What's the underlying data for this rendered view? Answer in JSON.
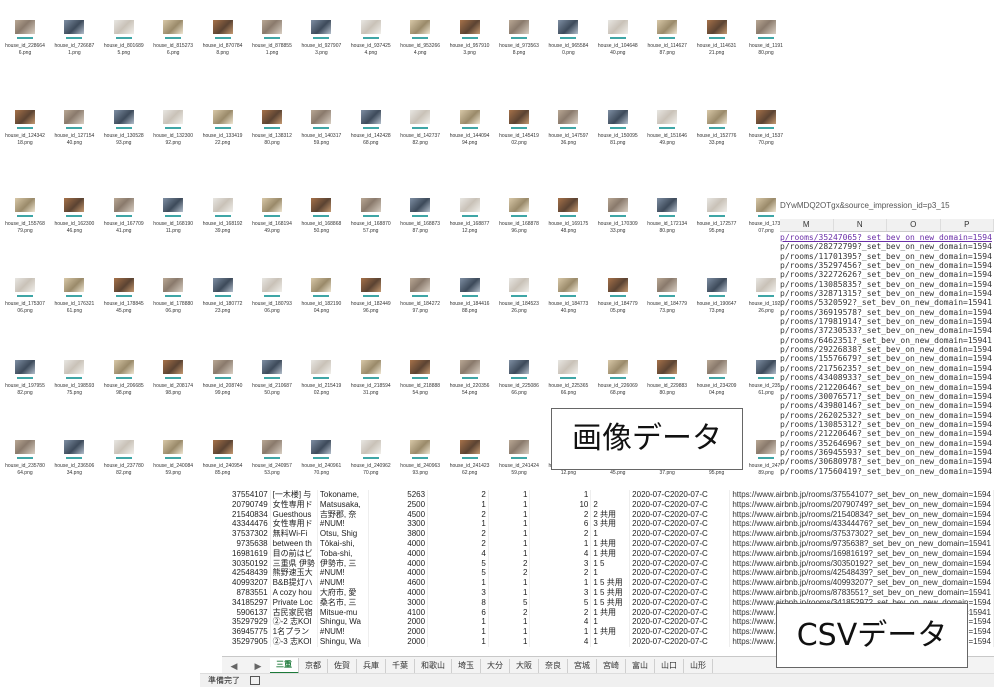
{
  "image_grid": {
    "rows": [
      [
        "house_id_228664\n6.png",
        "house_id_726687\n1.png",
        "house_id_801689\n5.png",
        "house_id_815273\n6.png",
        "house_id_870784\n8.png",
        "house_id_878855\n1.png",
        "house_id_927907\n3.png",
        "house_id_937425\n4.png",
        "house_id_953266\n4.png",
        "house_id_957910\n3.png",
        "house_id_973563\n8.png",
        "house_id_965584\n0.png",
        "house_id_104648\n40.png",
        "house_id_114627\n87.png",
        "house_id_114631\n21.png",
        "house_id_1191\n80.png"
      ],
      [
        "house_id_124342\n18.png",
        "house_id_127154\n40.png",
        "house_id_130528\n93.png",
        "house_id_132300\n92.png",
        "house_id_133419\n22.png",
        "house_id_138312\n80.png",
        "house_id_140317\n59.png",
        "house_id_142428\n68.png",
        "house_id_142737\n82.png",
        "house_id_144094\n94.png",
        "house_id_145419\n02.png",
        "house_id_147597\n36.png",
        "house_id_150095\n81.png",
        "house_id_151646\n49.png",
        "house_id_152776\n33.png",
        "house_id_1537\n70.png"
      ],
      [
        "house_id_155768\n79.png",
        "house_id_162300\n46.png",
        "house_id_167709\n41.png",
        "house_id_168190\n11.png",
        "house_id_168192\n39.png",
        "house_id_168194\n49.png",
        "house_id_168868\n50.png",
        "house_id_168870\n57.png",
        "house_id_168873\n87.png",
        "house_id_168877\n12.png",
        "house_id_168878\n96.png",
        "house_id_169175\n48.png",
        "house_id_170309\n33.png",
        "house_id_172134\n80.png",
        "house_id_172577\n95.png",
        "house_id_1730\n07.png"
      ],
      [
        "house_id_175307\n06.png",
        "house_id_176321\n61.png",
        "house_id_178845\n45.png",
        "house_id_178880\n06.png",
        "house_id_180772\n23.png",
        "house_id_180793\n06.png",
        "house_id_182190\n04.png",
        "house_id_182449\n96.png",
        "house_id_184272\n97.png",
        "house_id_184416\n88.png",
        "house_id_184523\n26.png",
        "house_id_184773\n40.png",
        "house_id_184779\n05.png",
        "house_id_184779\n73.png",
        "house_id_190647\n73.png",
        "house_id_1921\n26.png"
      ],
      [
        "house_id_197955\n82.png",
        "house_id_198593\n75.png",
        "house_id_206685\n98.png",
        "house_id_208174\n98.png",
        "house_id_208740\n99.png",
        "house_id_210687\n50.png",
        "house_id_215419\n02.png",
        "house_id_218594\n31.png",
        "house_id_218888\n54.png",
        "house_id_220356\n54.png",
        "house_id_225086\n66.png",
        "house_id_225365\n66.png",
        "house_id_226069\n68.png",
        "house_id_229883\n80.png",
        "house_id_234209\n04.png",
        "house_id_2351\n61.png"
      ],
      [
        "house_id_235780\n64.png",
        "house_id_236506\n34.png",
        "house_id_237780\n82.png",
        "house_id_240084\n59.png",
        "house_id_240954\n85.png",
        "house_id_240957\n53.png",
        "house_id_240961\n70.png",
        "house_id_240962\n70.png",
        "house_id_240963\n93.png",
        "house_id_241423\n62.png",
        "house_id_241424\n59.png",
        "house_id_241425\n12.png",
        "house_id_241425\n45.png",
        "house_id_241426\n37.png",
        "house_id_241427\n95.png",
        "house_id_2474\n89.png"
      ]
    ]
  },
  "csv_pane": {
    "url_fragment": "DYwMDQ2OTgx&source_impression_id=p3_15",
    "columns": [
      "M",
      "N",
      "O",
      "P"
    ],
    "links": [
      "p/rooms/35247065?_set_bev_on_new_domain=1594",
      "p/rooms/28272799?_set_bev_on_new_domain=1594",
      "p/rooms/11701395?_set_bev_on_new_domain=1594",
      "p/rooms/35297456?_set_bev_on_new_domain=1594",
      "p/rooms/32272626?_set_bev_on_new_domain=1594",
      "p/rooms/13085835?_set_bev_on_new_domain=1594",
      "p/rooms/32871315?_set_bev_on_new_domain=1594",
      "p/rooms/5320592?_set_bev_on_new_domain=15941",
      "p/rooms/36919578?_set_bev_on_new_domain=1594",
      "p/rooms/17981914?_set_bev_on_new_domain=1594",
      "p/rooms/37230533?_set_bev_on_new_domain=1594",
      "p/rooms/6462351?_set_bev_on_new_domain=15941",
      "p/rooms/29226838?_set_bev_on_new_domain=1594",
      "p/rooms/15576679?_set_bev_on_new_domain=1594",
      "p/rooms/21756235?_set_bev_on_new_domain=1594",
      "p/rooms/43408933?_set_bev_on_new_domain=1594",
      "p/rooms/21220646?_set_bev_on_new_domain=1594",
      "p/rooms/30076571?_set_bev_on_new_domain=1594",
      "p/rooms/43980146?_set_bev_on_new_domain=1594",
      "p/rooms/26202532?_set_bev_on_new_domain=1594",
      "p/rooms/13085312?_set_bev_on_new_domain=1594",
      "p/rooms/21220646?_set_bev_on_new_domain=1594",
      "p/rooms/35264696?_set_bev_on_new_domain=1594",
      "p/rooms/36945593?_set_bev_on_new_domain=1594",
      "p/rooms/30680978?_set_bev_on_new_domain=1594",
      "p/rooms/17560419?_set_bev_on_new_domain=1594"
    ]
  },
  "csv_rows": [
    [
      "37554107",
      "[一木楼] 与",
      "Tokoname,",
      "5263",
      "2",
      "1",
      "1",
      "",
      "2020-07-C2020-07-C",
      "https://www.airbnb.jp/rooms/37554107?_set_bev_on_new_domain=1594"
    ],
    [
      "20790749",
      "女性専用ド",
      "Matsusaka,",
      "2500",
      "1",
      "1",
      "10",
      "2",
      "2020-07-C2020-07-C",
      "https://www.airbnb.jp/rooms/20790749?_set_bev_on_new_domain=1594"
    ],
    [
      "21540834",
      "Guesthous",
      "吉野郡, 奈",
      "4500",
      "2",
      "1",
      "2",
      "2 共用",
      "2020-07-C2020-07-C",
      "https://www.airbnb.jp/rooms/21540834?_set_bev_on_new_domain=1594"
    ],
    [
      "43344476",
      "女性専用ド",
      "#NUM!",
      "3300",
      "1",
      "1",
      "6",
      "3 共用",
      "2020-07-C2020-07-C",
      "https://www.airbnb.jp/rooms/43344476?_set_bev_on_new_domain=1594"
    ],
    [
      "37537302",
      "無料Wi-Fi",
      "Otsu, Shig",
      "3800",
      "2",
      "1",
      "2",
      "1",
      "2020-07-C2020-07-C",
      "https://www.airbnb.jp/rooms/37537302?_set_bev_on_new_domain=1594"
    ],
    [
      "9735638",
      "between th",
      "Tōkai-shi,",
      "4000",
      "2",
      "1",
      "1",
      "1 共用",
      "2020-07-C2020-07-C",
      "https://www.airbnb.jp/rooms/9735638?_set_bev_on_new_domain=15941"
    ],
    [
      "16981619",
      "目の前はビ",
      "Toba-shi,",
      "4000",
      "4",
      "1",
      "4",
      "1 共用",
      "2020-07-C2020-07-C",
      "https://www.airbnb.jp/rooms/16981619?_set_bev_on_new_domain=1594"
    ],
    [
      "30350192",
      "三重県 伊勢",
      "伊勢市, 三",
      "4000",
      "5",
      "2",
      "3",
      "1 5",
      "2020-07-C2020-07-C",
      "https://www.airbnb.jp/rooms/30350192?_set_bev_on_new_domain=1594"
    ],
    [
      "42548439",
      "熊野速玉大",
      "#NUM!",
      "4000",
      "5",
      "2",
      "2",
      "1",
      "2020-07-C2020-07-C",
      "https://www.airbnb.jp/rooms/42548439?_set_bev_on_new_domain=1594"
    ],
    [
      "40993207",
      "B&B提灯ハ",
      "#NUM!",
      "4600",
      "1",
      "1",
      "1",
      "1 5 共用",
      "2020-07-C2020-07-C",
      "https://www.airbnb.jp/rooms/40993207?_set_bev_on_new_domain=1594"
    ],
    [
      "8783551",
      "A cozy hou",
      "大府市, 愛",
      "4000",
      "3",
      "1",
      "3",
      "1 5 共用",
      "2020-07-C2020-07-C",
      "https://www.airbnb.jp/rooms/8783551?_set_bev_on_new_domain=15941"
    ],
    [
      "34185297",
      "Private Loc",
      "桑名市, 三",
      "3000",
      "8",
      "5",
      "5",
      "1 5 共用",
      "2020-07-C2020-07-C",
      "https://www.airbnb.jp/rooms/34185297?_set_bev_on_new_domain=1594"
    ],
    [
      "5906137",
      "古民家民宿",
      "Mitsue-mu",
      "4100",
      "6",
      "2",
      "2",
      "1 共用",
      "2020-07-C2020-07-C",
      "https://www.airbnb.jp/rooms/5906137?_set_bev_on_new_domain=15941"
    ],
    [
      "35297929",
      "②-2 志KOI",
      "Shingu, Wa",
      "2000",
      "1",
      "1",
      "4",
      "1",
      "2020-07-C2020-07-C",
      "https://www.airbnb.jp/rooms/35297929?_set_bev_on_new_domain=1594"
    ],
    [
      "36945775",
      "1名プラン",
      "#NUM!",
      "2000",
      "1",
      "1",
      "1",
      "1 共用",
      "2020-07-C2020-07-C",
      "https://www.airbnb.jp/rooms/36945775?_set_bev_on_new_domain=1594"
    ],
    [
      "35297905",
      "②-3 志KOI",
      "Shingu, Wa",
      "2000",
      "1",
      "1",
      "4",
      "1",
      "2020-07-C2020-07-C",
      "https://www.airbnb.jp/rooms/35297905?_set_bev_on_new_domain=1594"
    ]
  ],
  "sheet_tabs": [
    "三重",
    "京都",
    "佐賀",
    "兵庫",
    "千葉",
    "和歌山",
    "埼玉",
    "大分",
    "大阪",
    "奈良",
    "宮城",
    "宮崎",
    "富山",
    "山口",
    "山形"
  ],
  "active_tab": "三重",
  "status": {
    "text": "準備完了",
    "icon": "sheet-icon"
  },
  "annotations": {
    "image_label": "画像データ",
    "csv_label": "CSVデータ"
  }
}
